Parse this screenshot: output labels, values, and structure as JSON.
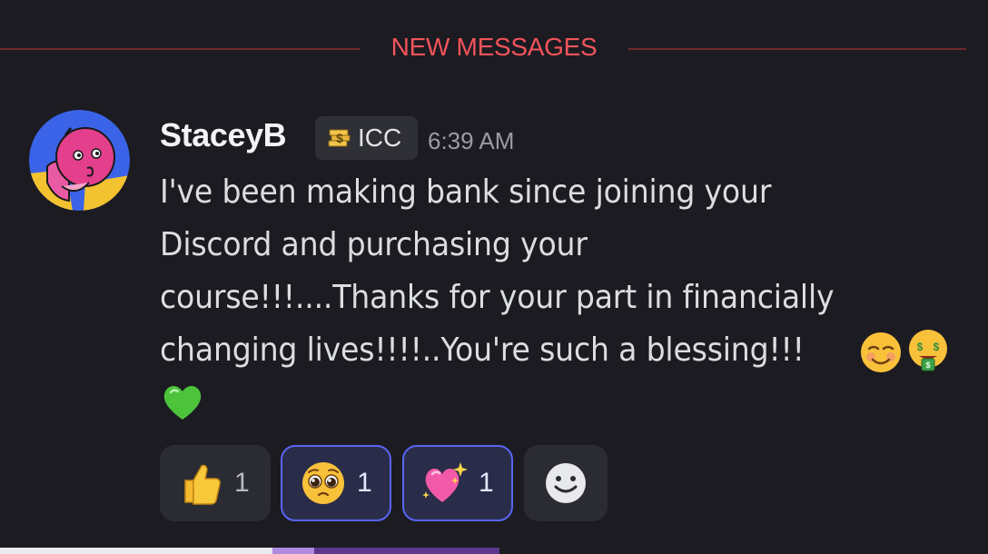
{
  "divider": {
    "label": "NEW MESSAGES"
  },
  "message": {
    "author": "StaceyB",
    "tag": "ICC",
    "timestamp": "6:39 AM",
    "lines": [
      "I've been making bank  since joining your",
      "Discord and purchasing your",
      "course!!!....Thanks for your part in financially",
      "changing lives!!!!..You're such a blessing!!!"
    ],
    "inline_emojis": [
      "smiling-face-emoji",
      "money-mouth-face-emoji",
      "green-heart-emoji"
    ]
  },
  "reactions": [
    {
      "emoji": "thumbs-up-emoji",
      "count": "1",
      "selected": false
    },
    {
      "emoji": "pleading-face-emoji",
      "count": "1",
      "selected": true
    },
    {
      "emoji": "sparkling-heart-emoji",
      "count": "1",
      "selected": true
    }
  ],
  "add_reaction": {
    "icon": "add-reaction-smiley-icon"
  },
  "colors": {
    "background": "#1c1b22",
    "new_messages_red": "#f2545b",
    "selected_border": "#5865f2"
  }
}
